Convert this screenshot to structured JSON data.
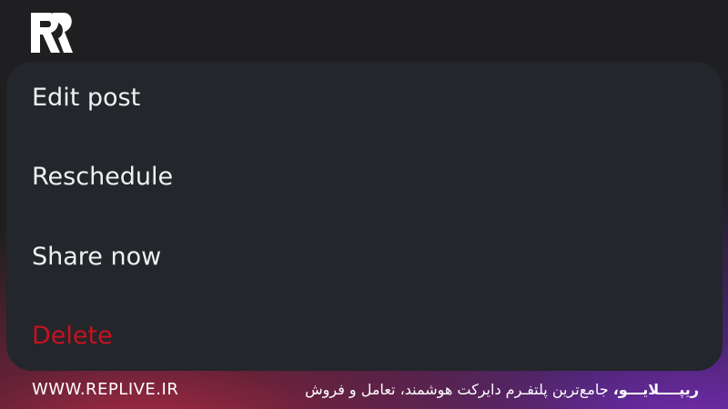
{
  "menu": {
    "items": [
      {
        "label": "Edit post"
      },
      {
        "label": "Reschedule"
      },
      {
        "label": "Share now"
      },
      {
        "label": "Delete",
        "danger_color": "#c8111f"
      }
    ]
  },
  "footer": {
    "website": "WWW.REPLIVE.IR",
    "brand_name": "ریپــــلایـــو،",
    "tagline": "جامع‌ترین پلتفـرم دایرکت هوشمند، تعامل و فروش"
  },
  "colors": {
    "card_background": "#23262b",
    "page_background": "#1f1f21",
    "text": "#f1f1f1",
    "gradient_left": "#c82d4b",
    "gradient_right": "#822dc8"
  },
  "logo": {
    "icon": "replive-logo-icon"
  }
}
